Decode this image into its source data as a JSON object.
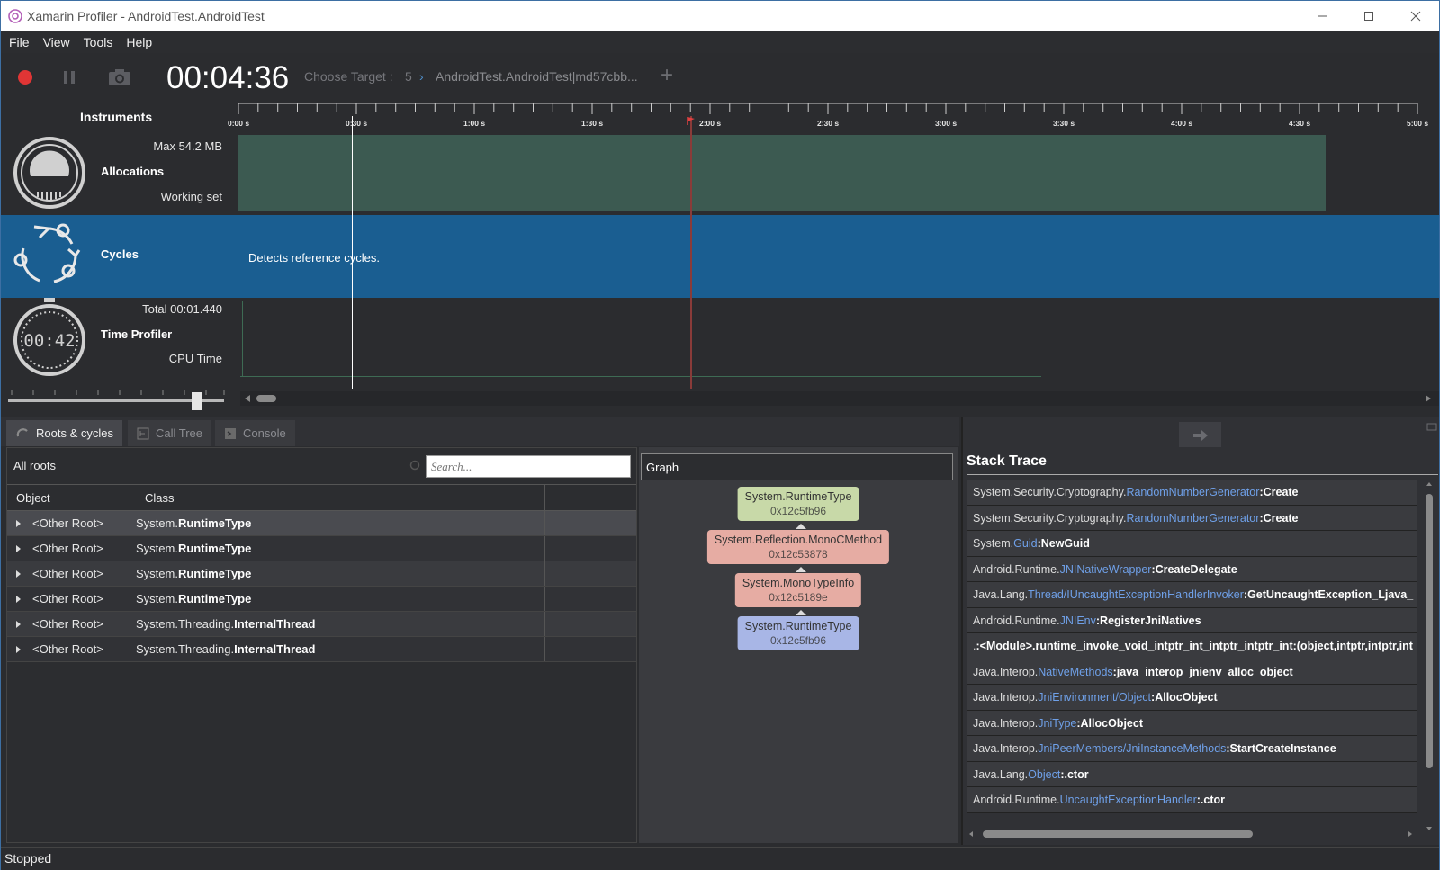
{
  "window": {
    "title": "Xamarin Profiler - AndroidTest.AndroidTest"
  },
  "menu": [
    "File",
    "View",
    "Tools",
    "Help"
  ],
  "toolbar": {
    "timer": "00:04:36",
    "choose_target_label": "Choose Target :",
    "target_count": "5",
    "target_name": "AndroidTest.AndroidTest|md57cbb...",
    "record_color": "#e03535"
  },
  "timeline": {
    "title": "Instruments",
    "ticks": [
      "0:00 s",
      "0:30 s",
      "1:00 s",
      "1:30 s",
      "2:00 s",
      "2:30 s",
      "3:00 s",
      "3:30 s",
      "4:00 s",
      "4:30 s",
      "5:00 s"
    ]
  },
  "instruments": {
    "allocations": {
      "name": "Allocations",
      "max": "Max 54.2 MB",
      "sub": "Working set"
    },
    "cycles": {
      "name": "Cycles",
      "desc": "Detects reference cycles."
    },
    "time_profiler": {
      "name": "Time Profiler",
      "total": "Total 00:01.440",
      "sub": "CPU Time",
      "icon_text": "00:42"
    }
  },
  "tabs": [
    {
      "label": "Roots & cycles",
      "icon": "cycle-icon",
      "active": true
    },
    {
      "label": "Call Tree",
      "icon": "tree-icon",
      "active": false
    },
    {
      "label": "Console",
      "icon": "console-icon",
      "active": false
    }
  ],
  "roots": {
    "title": "All roots",
    "search_placeholder": "Search...",
    "columns": [
      "Object",
      "Class",
      ""
    ],
    "rows": [
      {
        "object": "<Other Root>",
        "ns": "System.",
        "cls": "RuntimeType"
      },
      {
        "object": "<Other Root>",
        "ns": "System.",
        "cls": "RuntimeType"
      },
      {
        "object": "<Other Root>",
        "ns": "System.",
        "cls": "RuntimeType"
      },
      {
        "object": "<Other Root>",
        "ns": "System.",
        "cls": "RuntimeType"
      },
      {
        "object": "<Other Root>",
        "ns": "System.Threading.",
        "cls": "InternalThread"
      },
      {
        "object": "<Other Root>",
        "ns": "System.Threading.",
        "cls": "InternalThread"
      }
    ]
  },
  "graph": {
    "title": "Graph",
    "nodes": [
      {
        "type": "System.RuntimeType",
        "addr": "0x12c5fb96",
        "color": "#c8d9a8"
      },
      {
        "type": "System.Reflection.MonoCMethod",
        "addr": "0x12c53878",
        "color": "#e6aca3"
      },
      {
        "type": "System.MonoTypeInfo",
        "addr": "0x12c5189e",
        "color": "#e6aca3"
      },
      {
        "type": "System.RuntimeType",
        "addr": "0x12c5fb96",
        "color": "#a8b6e6"
      }
    ]
  },
  "stack_trace": {
    "title": "Stack Trace",
    "frames": [
      {
        "ns": "System.Security.Cryptography.",
        "type": "RandomNumberGenerator",
        "method": ":Create"
      },
      {
        "ns": "System.Security.Cryptography.",
        "type": "RandomNumberGenerator",
        "method": ":Create"
      },
      {
        "ns": "System.",
        "type": "Guid",
        "method": ":NewGuid"
      },
      {
        "ns": "Android.Runtime.",
        "type": "JNINativeWrapper",
        "method": ":CreateDelegate"
      },
      {
        "ns": "Java.Lang.",
        "type": "Thread/IUncaughtExceptionHandlerInvoker",
        "method": ":GetUncaughtException_Ljava_"
      },
      {
        "ns": "Android.Runtime.",
        "type": "JNIEnv",
        "method": ":RegisterJniNatives"
      },
      {
        "ns": ".",
        "type": "",
        "method": ":<Module>.runtime_invoke_void_intptr_int_intptr_intptr_int:(object,intptr,intptr,int"
      },
      {
        "ns": "Java.Interop.",
        "type": "NativeMethods",
        "method": ":java_interop_jnienv_alloc_object"
      },
      {
        "ns": "Java.Interop.",
        "type": "JniEnvironment/Object",
        "method": ":AllocObject"
      },
      {
        "ns": "Java.Interop.",
        "type": "JniType",
        "method": ":AllocObject"
      },
      {
        "ns": "Java.Interop.",
        "type": "JniPeerMembers/JniInstanceMethods",
        "method": ":StartCreateInstance"
      },
      {
        "ns": "Java.Lang.",
        "type": "Object",
        "method": ":.ctor"
      },
      {
        "ns": "Android.Runtime.",
        "type": "UncaughtExceptionHandler",
        "method": ":.ctor"
      }
    ]
  },
  "status": "Stopped"
}
